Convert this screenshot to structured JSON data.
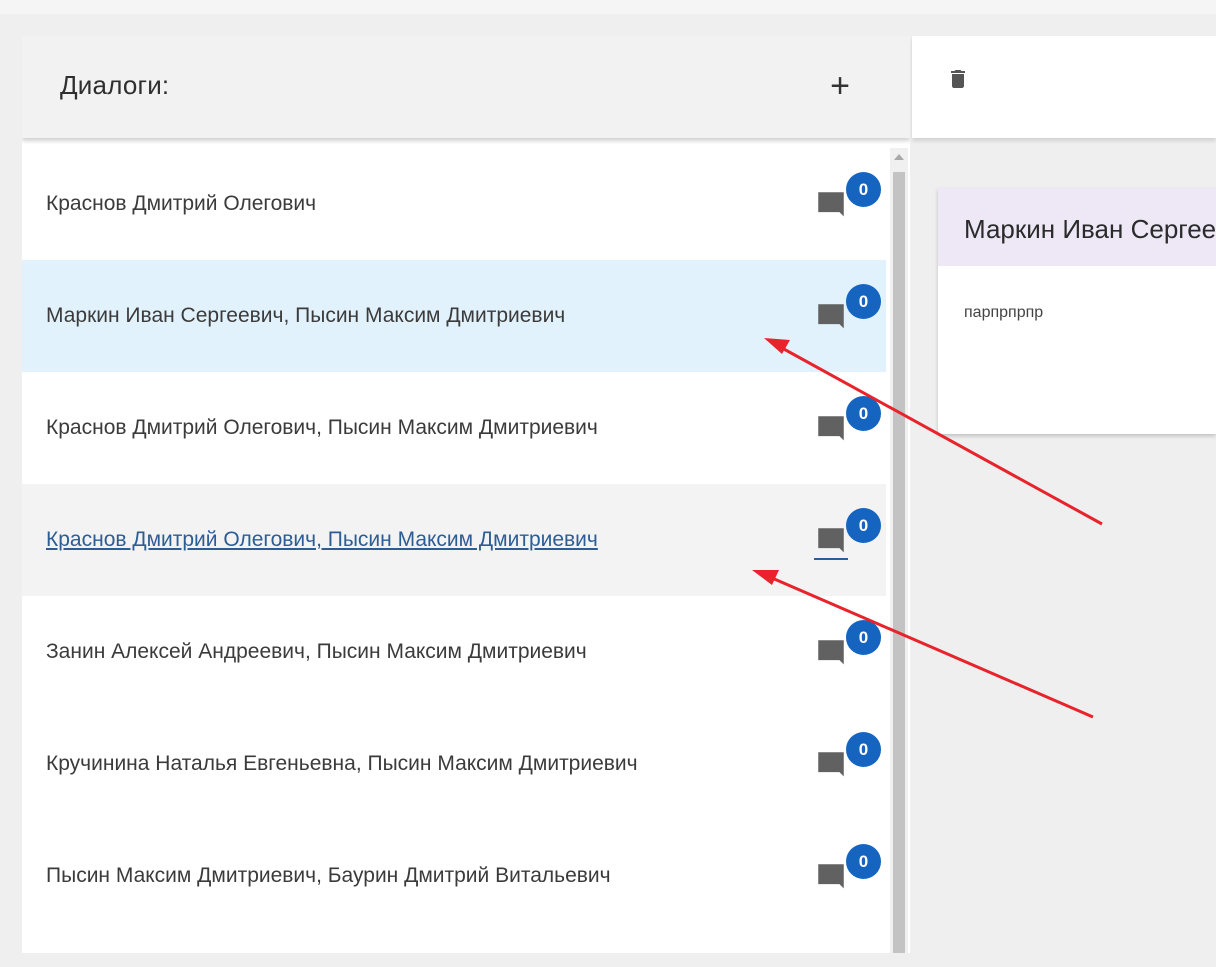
{
  "left_panel": {
    "title": "Диалоги:",
    "add_label": "+"
  },
  "dialogs": [
    {
      "label": "Краснов Дмитрий Олегович",
      "count": "0",
      "state": "normal"
    },
    {
      "label": "Маркин Иван Сергеевич, Пысин Максим Дмитриевич",
      "count": "0",
      "state": "selected"
    },
    {
      "label": "Краснов Дмитрий Олегович, Пысин Максим Дмитриевич",
      "count": "0",
      "state": "normal"
    },
    {
      "label": "Краснов Дмитрий Олегович, Пысин Максим Дмитриевич",
      "count": "0",
      "state": "hover"
    },
    {
      "label": "Занин Алексей Андреевич, Пысин Максим Дмитриевич",
      "count": "0",
      "state": "normal"
    },
    {
      "label": "Кручинина Наталья Евгеньевна, Пысин Максим Дмитриевич",
      "count": "0",
      "state": "normal"
    },
    {
      "label": "Пысин Максим Дмитриевич, Баурин Дмитрий Витальевич",
      "count": "0",
      "state": "normal"
    }
  ],
  "chat": {
    "card_title": "Маркин Иван Сергеевич, Пысин Максим Дмитриевич",
    "message": "парпрпрпр"
  },
  "colors": {
    "badge": "#1565c0",
    "selected_row": "#e1f2fc",
    "hover_row": "#f3f3f3",
    "card_header": "#ede7f6",
    "annotation_arrow": "#e8232b",
    "icon": "#616161"
  },
  "icons": {
    "add": "plus-icon",
    "delete": "trash-icon",
    "message": "chat-bubble-icon"
  }
}
